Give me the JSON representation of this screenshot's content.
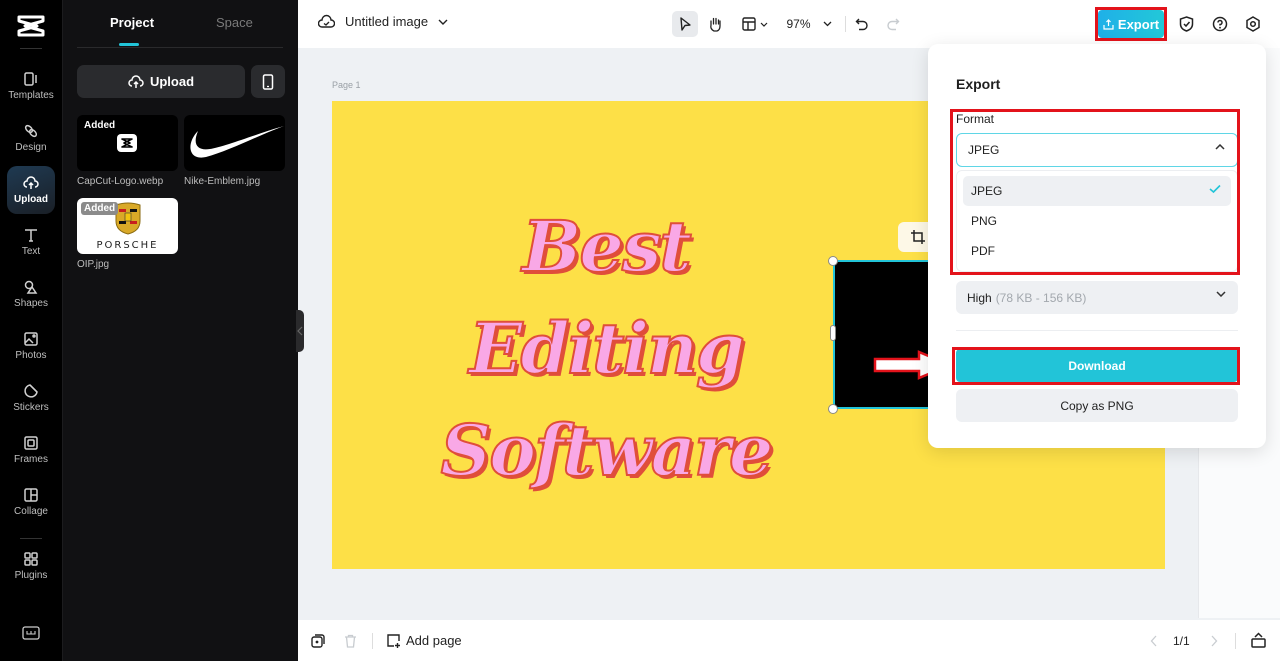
{
  "rail": {
    "items": [
      {
        "label": "Templates",
        "icon": "templates-icon"
      },
      {
        "label": "Design",
        "icon": "design-icon"
      },
      {
        "label": "Upload",
        "icon": "upload-cloud-icon",
        "active": true
      },
      {
        "label": "Text",
        "icon": "text-icon"
      },
      {
        "label": "Shapes",
        "icon": "shapes-icon"
      },
      {
        "label": "Photos",
        "icon": "photos-icon"
      },
      {
        "label": "Stickers",
        "icon": "stickers-icon"
      },
      {
        "label": "Frames",
        "icon": "frames-icon"
      },
      {
        "label": "Collage",
        "icon": "collage-icon"
      },
      {
        "label": "Plugins",
        "icon": "plugins-icon"
      }
    ]
  },
  "panel": {
    "tabs": [
      {
        "label": "Project",
        "active": true
      },
      {
        "label": "Space",
        "active": false
      }
    ],
    "upload_label": "Upload",
    "assets": [
      {
        "name": "CapCut-Logo.webp",
        "badge": "Added"
      },
      {
        "name": "Nike-Emblem.jpg",
        "badge": ""
      },
      {
        "name": "OIP.jpg",
        "badge": "Added",
        "caption": "PORSCHE"
      }
    ]
  },
  "topbar": {
    "title": "Untitled image",
    "zoom": "97%",
    "export_label": "Export"
  },
  "canvas": {
    "page_label": "Page 1",
    "headline": [
      "Best",
      "Editing",
      "Software"
    ],
    "background_color": "#fde047",
    "text_color": "#f9a8e6",
    "outline_color": "#e04e3a"
  },
  "export": {
    "title": "Export",
    "format_label": "Format",
    "format_value": "JPEG",
    "format_options": [
      "JPEG",
      "PNG",
      "PDF"
    ],
    "selected_option": "JPEG",
    "quality_label": "High",
    "quality_range": "(78 KB - 156 KB)",
    "download_label": "Download",
    "copy_label": "Copy as PNG"
  },
  "bottombar": {
    "add_page_label": "Add page",
    "page_counter": "1/1"
  },
  "colors": {
    "accent": "#22c4d8",
    "annotation_red": "#e3131b"
  }
}
